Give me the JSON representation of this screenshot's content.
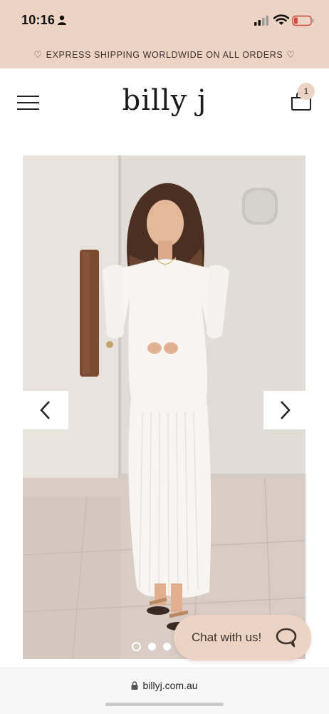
{
  "status_bar": {
    "time": "10:16"
  },
  "promo": {
    "heart": "♡",
    "text": "EXPRESS SHIPPING WORLDWIDE ON ALL ORDERS"
  },
  "header": {
    "logo": "billy j",
    "cart_count": "1"
  },
  "gallery": {
    "image_alt": "Model wearing long-sleeve white ribbed knit maxi dress",
    "slide_count": 4,
    "active_slide": 1
  },
  "chat": {
    "label": "Chat with us!"
  },
  "browser": {
    "url": "billyj.com.au"
  },
  "colors": {
    "accent": "#ecd3c4"
  }
}
